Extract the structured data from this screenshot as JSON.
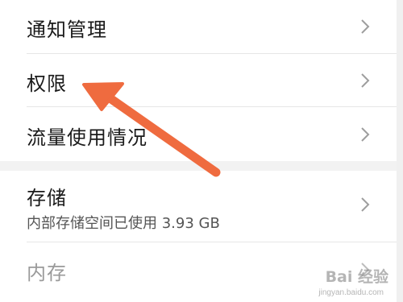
{
  "settings": {
    "items": [
      {
        "label": "通知管理"
      },
      {
        "label": "权限"
      },
      {
        "label": "流量使用情况"
      },
      {
        "label": "存储",
        "sub": "内部存储空间已使用 3.93 GB"
      },
      {
        "label": "内存"
      }
    ]
  },
  "icons": {
    "chevron": "chevron-right-icon",
    "arrow": "annotation-arrow"
  },
  "colors": {
    "arrow": "#ef6b3f",
    "text": "#1a1a1a",
    "text_dim": "#9a9a9a",
    "divider": "#e6e6e6"
  },
  "watermark": {
    "text": "Bai 经验",
    "url": "jingyan.baidu.com"
  }
}
